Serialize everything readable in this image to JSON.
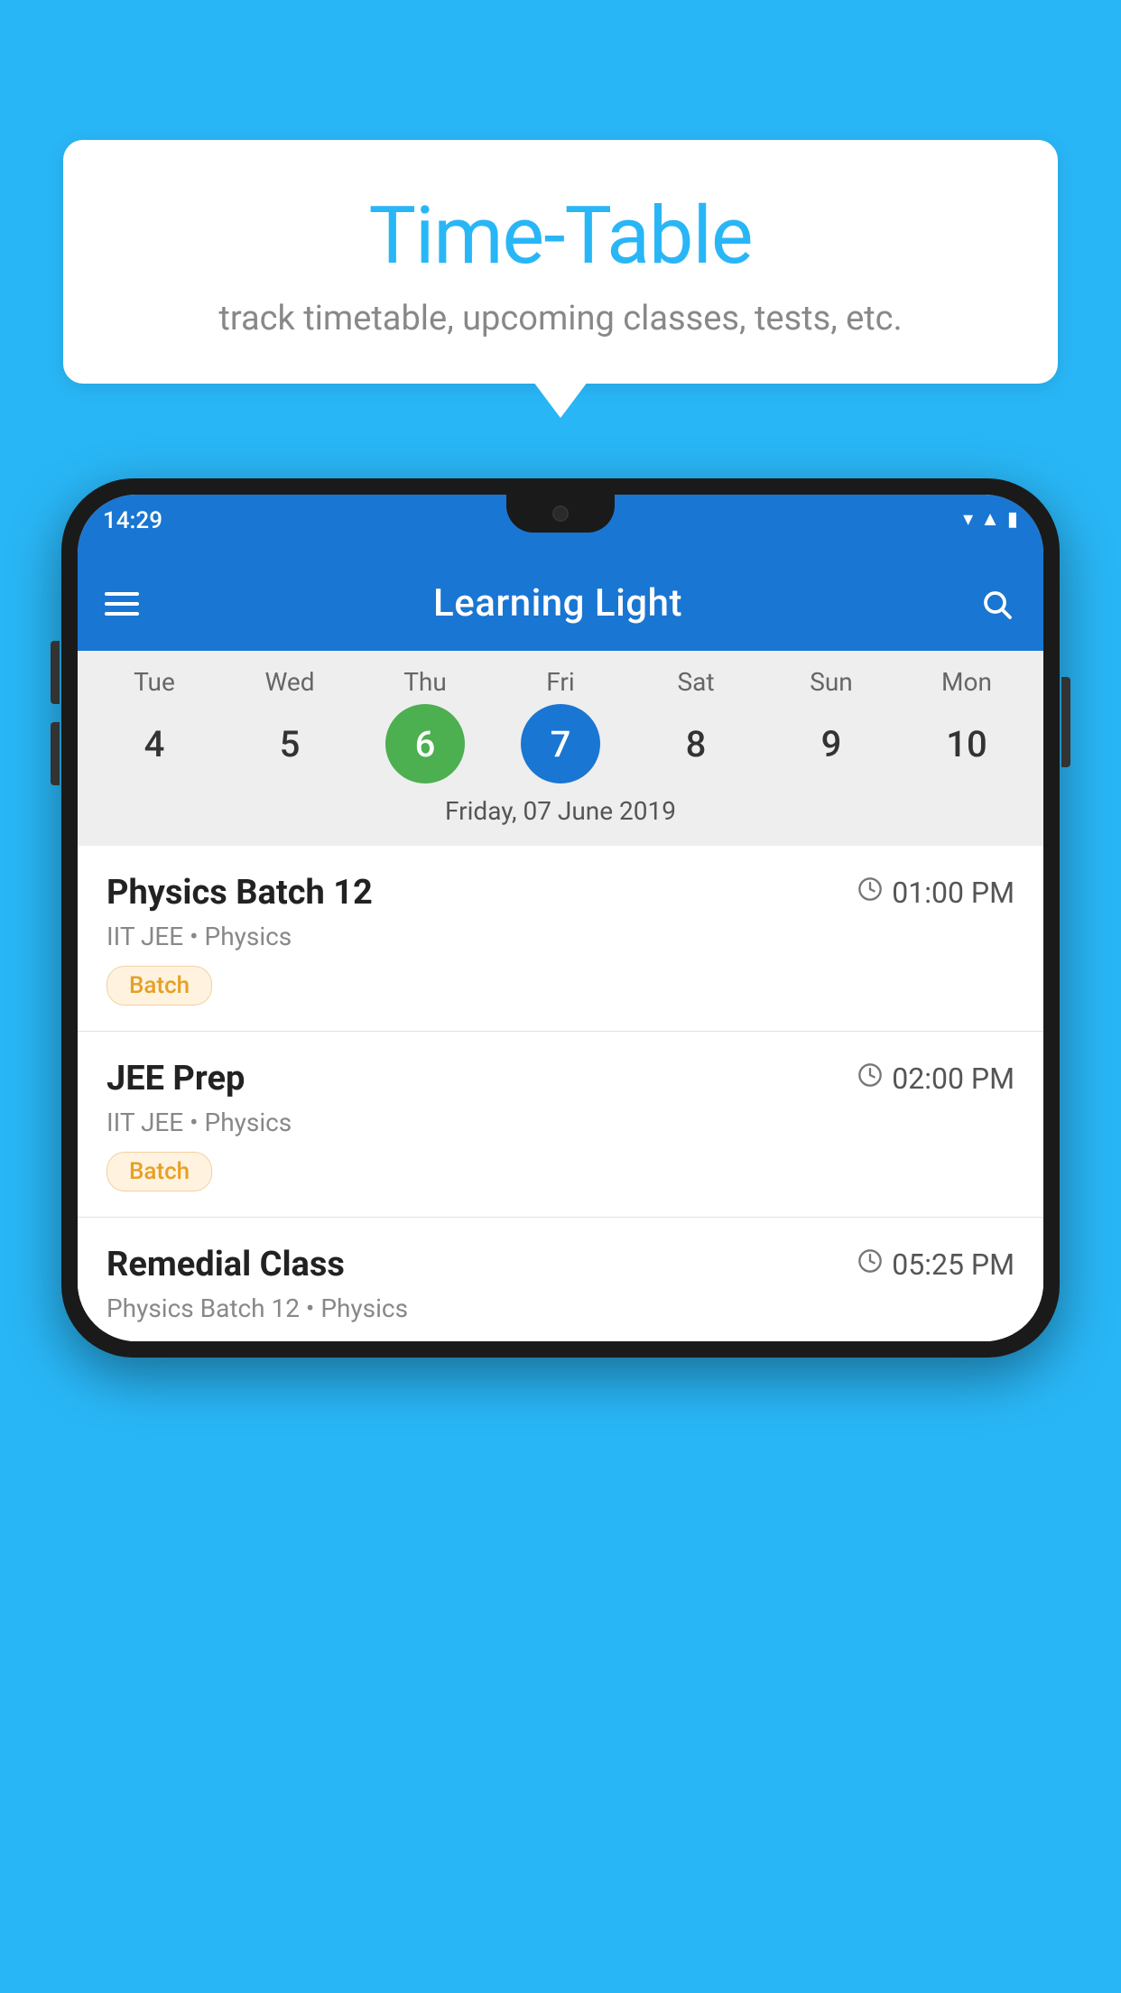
{
  "background_color": "#29B6F6",
  "bubble": {
    "title": "Time-Table",
    "subtitle": "track timetable, upcoming classes, tests, etc."
  },
  "phone": {
    "status_bar": {
      "time": "14:29"
    },
    "app_bar": {
      "title": "Learning Light"
    },
    "calendar": {
      "day_headers": [
        "Tue",
        "Wed",
        "Thu",
        "Fri",
        "Sat",
        "Sun",
        "Mon"
      ],
      "day_numbers": [
        4,
        5,
        6,
        7,
        8,
        9,
        10
      ],
      "today_index": 2,
      "selected_index": 3,
      "selected_date_label": "Friday, 07 June 2019"
    },
    "schedule_items": [
      {
        "title": "Physics Batch 12",
        "time": "01:00 PM",
        "subtitle": "IIT JEE • Physics",
        "tag": "Batch"
      },
      {
        "title": "JEE Prep",
        "time": "02:00 PM",
        "subtitle": "IIT JEE • Physics",
        "tag": "Batch"
      },
      {
        "title": "Remedial Class",
        "time": "05:25 PM",
        "subtitle": "Physics Batch 12 • Physics",
        "tag": null
      }
    ]
  }
}
